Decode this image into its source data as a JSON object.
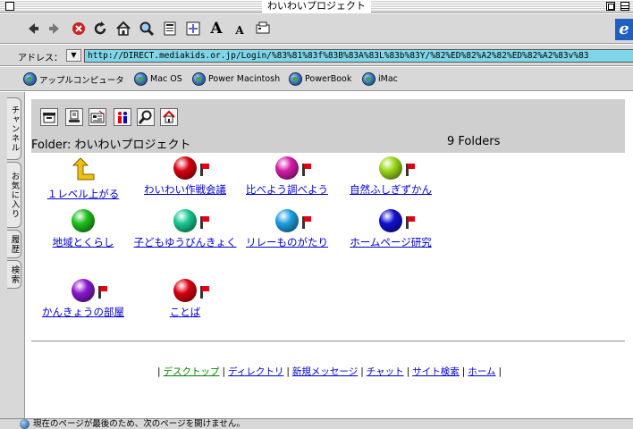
{
  "window": {
    "title": "わいわいプロジェクト"
  },
  "toolbar": {
    "buttons": [
      "back-icon",
      "forward-icon",
      "stop-icon",
      "refresh-icon",
      "home-icon",
      "search-icon",
      "favorites-icon",
      "history-icon",
      "larger-text-icon",
      "smaller-text-icon",
      "print-icon"
    ],
    "larger_text": "A",
    "smaller_text": "A",
    "ie_logo": "e"
  },
  "address": {
    "label": "アドレス：",
    "url": "http://DIRECT.mediakids.or.jp/Login/%83%81%83f%83B%83A%83L%83b%83Y/%82%ED%82%A2%82%ED%82%A2%83v%83"
  },
  "favorites": [
    {
      "label": "アップルコンピュータ"
    },
    {
      "label": "Mac OS"
    },
    {
      "label": "Power Macintosh"
    },
    {
      "label": "PowerBook"
    },
    {
      "label": "iMac"
    }
  ],
  "side_tabs": [
    "チャンネル",
    "お気に入り",
    "履歴",
    "検索"
  ],
  "folderbar": {
    "icons": [
      "desktop-icon",
      "directory-icon",
      "message-icon",
      "chat-icon",
      "site-search-icon",
      "home-icon"
    ],
    "folder_label": "Folder: わいわいプロジェクト",
    "folder_count": "9 Folders"
  },
  "items": [
    {
      "label": "１レベル上がる",
      "color": "up"
    },
    {
      "label": "わいわい作戦会議",
      "color": "#d80010"
    },
    {
      "label": "比べよう調べよう",
      "color": "#d41ca8"
    },
    {
      "label": "自然ふしぎずかん",
      "color": "#9ad81a"
    },
    {
      "label": "地域とくらし",
      "color": "#1ec01e"
    },
    {
      "label": "子どもゆうびんきょく",
      "color": "#18c890"
    },
    {
      "label": "リレーものがたり",
      "color": "#1ea0e0"
    },
    {
      "label": "ホームページ研究",
      "color": "#1010d0"
    },
    {
      "label": "かんきょうの部屋",
      "color": "#8a18d0"
    },
    {
      "label": "ことば",
      "color": "#d80010"
    }
  ],
  "footer": {
    "links": [
      "デスクトップ",
      "ディレクトリ",
      "新規メッセージ",
      "チャット",
      "サイト検索",
      "ホーム"
    ],
    "sep": "|"
  },
  "status": {
    "text": "現在のページが最後のため、次のページを開けません。"
  }
}
